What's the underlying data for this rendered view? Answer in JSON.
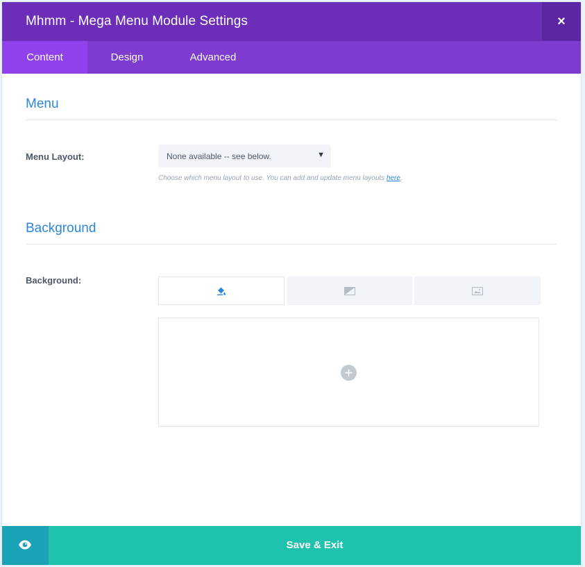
{
  "header": {
    "title": "Mhmm - Mega Menu Module Settings",
    "close_label": "×"
  },
  "tabs": [
    {
      "label": "Content",
      "active": true
    },
    {
      "label": "Design",
      "active": false
    },
    {
      "label": "Advanced",
      "active": false
    }
  ],
  "menu_section": {
    "title": "Menu",
    "layout_label": "Menu Layout:",
    "layout_value": "None available -- see below.",
    "help_text": "Choose which menu layout to use. You can add and update menu layouts ",
    "help_link": "here",
    "help_suffix": "."
  },
  "background_section": {
    "title": "Background",
    "label": "Background:",
    "tab_icons": [
      "paint-bucket-icon",
      "gradient-icon",
      "image-icon"
    ],
    "active_tab_index": 0
  },
  "footer": {
    "save_label": "Save & Exit",
    "preview_icon": "eye-icon"
  },
  "colors": {
    "header": "#6c2eb9",
    "tabs": "#7e3bd0",
    "tab_active": "#8f42ec",
    "accent_blue": "#2b87da",
    "save": "#1ec2ad",
    "preview": "#1aa3b6"
  }
}
